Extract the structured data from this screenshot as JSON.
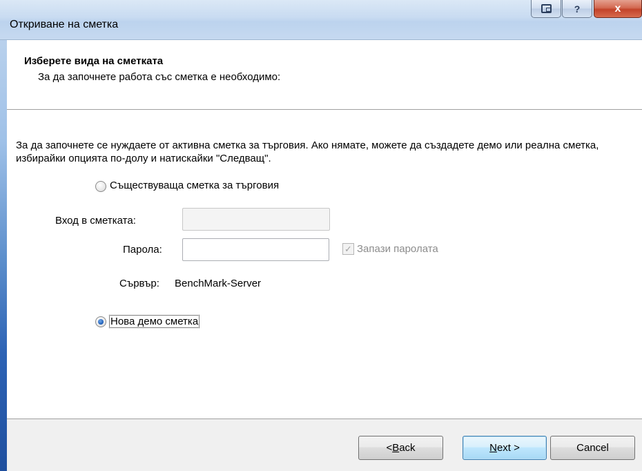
{
  "window": {
    "title": "Откриване на сметка",
    "help_label": "?",
    "close_label": "x"
  },
  "header": {
    "heading": "Изберете вида на сметката",
    "subheading": "За да започнете работа със сметка е необходимо:"
  },
  "main": {
    "intro": "За да започнете се нуждаете от активна сметка за търговия. Ако нямате, можете да създадете демо или реална сметка, избирайки опцията по-долу и натискайки \"Следващ\".",
    "existing_account_label": "Съществуваща сметка за търговия",
    "login_label": "Вход в сметката:",
    "login_value": "",
    "password_label": "Парола:",
    "password_value": "",
    "save_password_label": "Запази паролата",
    "save_password_checked": true,
    "server_label": "Сървър:",
    "server_value": "BenchMark-Server",
    "new_demo_label": "Нова демо сметка",
    "selected_option": "new_demo"
  },
  "footer": {
    "back_prefix": "< ",
    "back_key": "B",
    "back_rest": "ack",
    "next_key": "N",
    "next_rest": "ext >",
    "cancel_label": "Cancel"
  }
}
